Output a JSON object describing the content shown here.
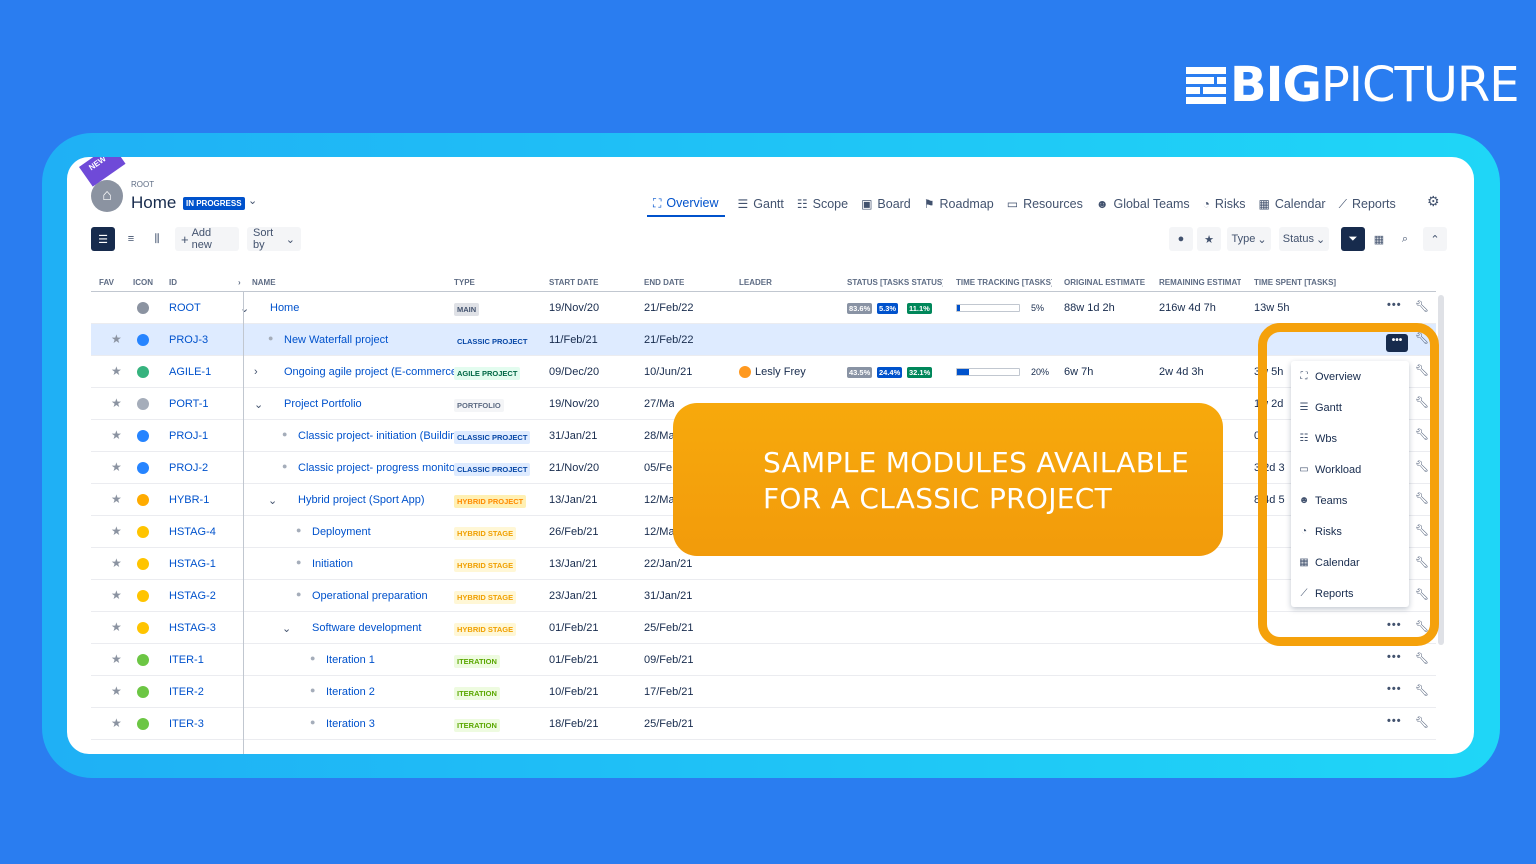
{
  "brand": {
    "bold": "BIG",
    "regular": "PICTURE"
  },
  "header": {
    "ribbon": "NEW",
    "root_label": "ROOT",
    "title": "Home",
    "status_badge": "IN PROGRESS"
  },
  "nav": [
    {
      "label": "Overview",
      "icon": "hierarchy-icon"
    },
    {
      "label": "Gantt",
      "icon": "gantt-icon"
    },
    {
      "label": "Scope",
      "icon": "list-icon"
    },
    {
      "label": "Board",
      "icon": "board-icon"
    },
    {
      "label": "Roadmap",
      "icon": "roadmap-icon"
    },
    {
      "label": "Resources",
      "icon": "resources-icon"
    },
    {
      "label": "Global Teams",
      "icon": "teams-icon"
    },
    {
      "label": "Risks",
      "icon": "risks-icon"
    },
    {
      "label": "Calendar",
      "icon": "calendar-icon"
    },
    {
      "label": "Reports",
      "icon": "reports-icon"
    }
  ],
  "toolbar": {
    "add_new": "Add new",
    "sort_by": "Sort by",
    "type": "Type",
    "status": "Status"
  },
  "columns": [
    "FAV",
    "ICON",
    "ID",
    "NAME",
    "TYPE",
    "START DATE",
    "END DATE",
    "LEADER",
    "STATUS [TASKS STATUS]",
    "TIME TRACKING [TASKS]",
    "ORIGINAL ESTIMATE",
    "REMAINING ESTIMATE",
    "TIME SPENT [TASKS]"
  ],
  "rows": [
    {
      "id": "ROOT",
      "name": "Home",
      "type": "MAIN",
      "start": "19/Nov/20",
      "end": "21/Feb/22",
      "leader": "",
      "status": [
        "83.6%",
        "5.3%",
        "11.1%"
      ],
      "tt": "5%",
      "tt_fill": 0.05,
      "orig": "88w 1d 2h",
      "rem": "216w 4d 7h",
      "spent": "13w 5h"
    },
    {
      "id": "PROJ-3",
      "name": "New Waterfall project",
      "type": "CLASSIC PROJECT",
      "start": "11/Feb/21",
      "end": "21/Feb/22",
      "leader": "",
      "status": [],
      "tt": "",
      "orig": "",
      "rem": "",
      "spent": ""
    },
    {
      "id": "AGILE-1",
      "name": "Ongoing agile project (E-commerce p",
      "type": "AGILE PROJECT",
      "start": "09/Dec/20",
      "end": "10/Jun/21",
      "leader": "Lesly Frey",
      "status": [
        "43.5%",
        "24.4%",
        "32.1%"
      ],
      "tt": "20%",
      "tt_fill": 0.2,
      "orig": "6w 7h",
      "rem": "2w 4d 3h",
      "spent": "3w 5h"
    },
    {
      "id": "PORT-1",
      "name": "Project Portfolio",
      "type": "PORTFOLIO",
      "start": "19/Nov/20",
      "end": "27/May/21",
      "leader": "",
      "status": [],
      "tt": "",
      "orig": "",
      "rem": "",
      "spent": "1w 2d"
    },
    {
      "id": "PROJ-1",
      "name": "Classic project- initiation (Building",
      "type": "CLASSIC PROJECT",
      "start": "31/Jan/21",
      "end": "28/Ma",
      "leader": "",
      "status": [],
      "tt": "",
      "orig": "",
      "rem": "",
      "spent": "0"
    },
    {
      "id": "PROJ-2",
      "name": "Classic project- progress monitor",
      "type": "CLASSIC PROJECT",
      "start": "21/Nov/20",
      "end": "05/Fe",
      "leader": "",
      "status": [],
      "tt": "",
      "orig": "",
      "rem": "",
      "spent": "3 2d 3"
    },
    {
      "id": "HYBR-1",
      "name": "Hybrid project (Sport App)",
      "type": "HYBRID PROJECT",
      "start": "13/Jan/21",
      "end": "12/Ma",
      "leader": "",
      "status": [],
      "tt": "",
      "orig": "",
      "rem": "",
      "spent": "8 4d 5"
    },
    {
      "id": "HSTAG-4",
      "name": "Deployment",
      "type": "HYBRID STAGE",
      "start": "26/Feb/21",
      "end": "12/Ma",
      "leader": "",
      "status": [],
      "tt": "",
      "orig": "",
      "rem": "",
      "spent": ""
    },
    {
      "id": "HSTAG-1",
      "name": "Initiation",
      "type": "HYBRID STAGE",
      "start": "13/Jan/21",
      "end": "22/Jan/21",
      "leader": "",
      "status": [],
      "tt": "",
      "orig": "",
      "rem": "",
      "spent": ""
    },
    {
      "id": "HSTAG-2",
      "name": "Operational preparation",
      "type": "HYBRID STAGE",
      "start": "23/Jan/21",
      "end": "31/Jan/21",
      "leader": "",
      "status": [],
      "tt": "",
      "orig": "",
      "rem": "",
      "spent": ""
    },
    {
      "id": "HSTAG-3",
      "name": "Software development",
      "type": "HYBRID STAGE",
      "start": "01/Feb/21",
      "end": "25/Feb/21",
      "leader": "",
      "status": [],
      "tt": "",
      "orig": "",
      "rem": "",
      "spent": ""
    },
    {
      "id": "ITER-1",
      "name": "Iteration 1",
      "type": "ITERATION",
      "start": "01/Feb/21",
      "end": "09/Feb/21",
      "leader": "",
      "status": [],
      "tt": "",
      "orig": "",
      "rem": "",
      "spent": ""
    },
    {
      "id": "ITER-2",
      "name": "Iteration 2",
      "type": "ITERATION",
      "start": "10/Feb/21",
      "end": "17/Feb/21",
      "leader": "",
      "status": [],
      "tt": "",
      "orig": "",
      "rem": "",
      "spent": ""
    },
    {
      "id": "ITER-3",
      "name": "Iteration 3",
      "type": "ITERATION",
      "start": "18/Feb/21",
      "end": "25/Feb/21",
      "leader": "",
      "status": [],
      "tt": "",
      "orig": "",
      "rem": "",
      "spent": ""
    }
  ],
  "callout": {
    "line1": "SAMPLE MODULES AVAILABLE",
    "line2": "FOR A CLASSIC PROJECT"
  },
  "module_menu": [
    {
      "label": "Overview",
      "icon": "hierarchy-icon"
    },
    {
      "label": "Gantt",
      "icon": "gantt-icon"
    },
    {
      "label": "Wbs",
      "icon": "list-icon"
    },
    {
      "label": "Workload",
      "icon": "resources-icon"
    },
    {
      "label": "Teams",
      "icon": "teams-icon"
    },
    {
      "label": "Risks",
      "icon": "risks-icon"
    },
    {
      "label": "Calendar",
      "icon": "calendar-icon"
    },
    {
      "label": "Reports",
      "icon": "reports-icon"
    }
  ],
  "colors": {
    "accent": "#0052cc",
    "callout": "#f5a10b",
    "background": "#2a7df0"
  }
}
